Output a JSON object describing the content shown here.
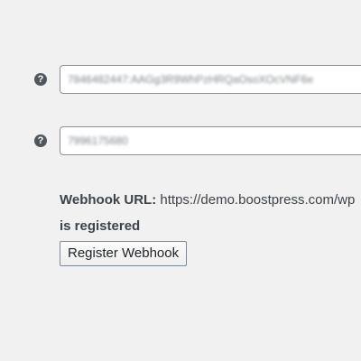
{
  "fields": [
    {
      "help_icon": "question-circle-icon",
      "help_glyph": "?",
      "value": "7846482447:AAGg3R9WhPzHRQaOsoXOcVNF6e"
    },
    {
      "help_icon": "question-circle-icon",
      "help_glyph": "?",
      "value": "7996175680"
    }
  ],
  "webhook": {
    "label": "Webhook URL:",
    "url": "https://demo.boostpress.com/wp",
    "status": "is registered",
    "register_button_label": "Register Webhook"
  }
}
